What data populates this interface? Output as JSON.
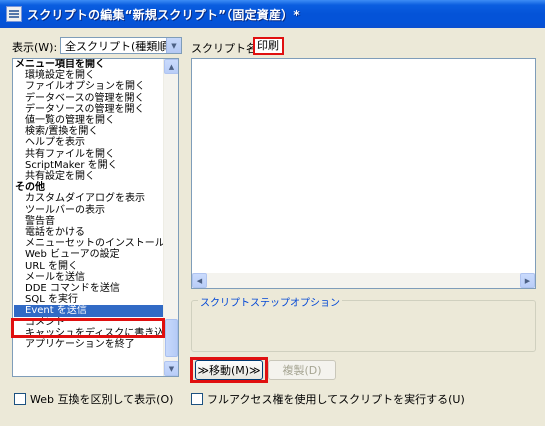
{
  "window": {
    "title": "スクリプトの編集“新規スクリプト”（固定資産）*"
  },
  "display": {
    "label": "表示(W):",
    "selected": "全スクリプト(種類順)"
  },
  "script_name": {
    "label": "スクリプト名(T):",
    "value": "印刷"
  },
  "steps": [
    {
      "text": "メニュー項目を開く",
      "kind": "cat"
    },
    {
      "text": "環境設定を開く",
      "kind": "sub"
    },
    {
      "text": "ファイルオプションを開く",
      "kind": "sub"
    },
    {
      "text": "データベースの管理を開く",
      "kind": "sub"
    },
    {
      "text": "データソースの管理を開く",
      "kind": "sub"
    },
    {
      "text": "値一覧の管理を開く",
      "kind": "sub"
    },
    {
      "text": "検索/置換を開く",
      "kind": "sub"
    },
    {
      "text": "ヘルプを表示",
      "kind": "sub"
    },
    {
      "text": "共有ファイルを開く",
      "kind": "sub"
    },
    {
      "text": "ScriptMaker を開く",
      "kind": "sub"
    },
    {
      "text": "共有設定を開く",
      "kind": "sub"
    },
    {
      "text": "その他",
      "kind": "cat"
    },
    {
      "text": "カスタムダイアログを表示",
      "kind": "sub"
    },
    {
      "text": "ツールバーの表示",
      "kind": "sub"
    },
    {
      "text": "警告音",
      "kind": "sub"
    },
    {
      "text": "電話をかける",
      "kind": "sub"
    },
    {
      "text": "メニューセットのインストール",
      "kind": "sub"
    },
    {
      "text": "Web ビューアの設定",
      "kind": "sub"
    },
    {
      "text": "URL を開く",
      "kind": "sub"
    },
    {
      "text": "メールを送信",
      "kind": "sub"
    },
    {
      "text": "DDE コマンドを送信",
      "kind": "sub"
    },
    {
      "text": "SQL を実行",
      "kind": "sub"
    },
    {
      "text": "Event を送信",
      "kind": "selected"
    },
    {
      "text": "コメント",
      "kind": "sub"
    },
    {
      "text": "キャッシュをディスクに書き込む",
      "kind": "sub"
    },
    {
      "text": "アプリケーションを終了",
      "kind": "sub"
    }
  ],
  "step_options": {
    "label": "スクリプトステップオプション"
  },
  "buttons": {
    "move": "≫移動(M)≫",
    "duplicate": "複製(D)"
  },
  "options": {
    "web_compat": "Web 互換を区別して表示(O)",
    "full_access": "フルアクセス権を使用してスクリプトを実行する(U)"
  },
  "colors": {
    "selection": "#316ac5",
    "highlight": "#e01010",
    "titlebar": "#0453d8"
  }
}
